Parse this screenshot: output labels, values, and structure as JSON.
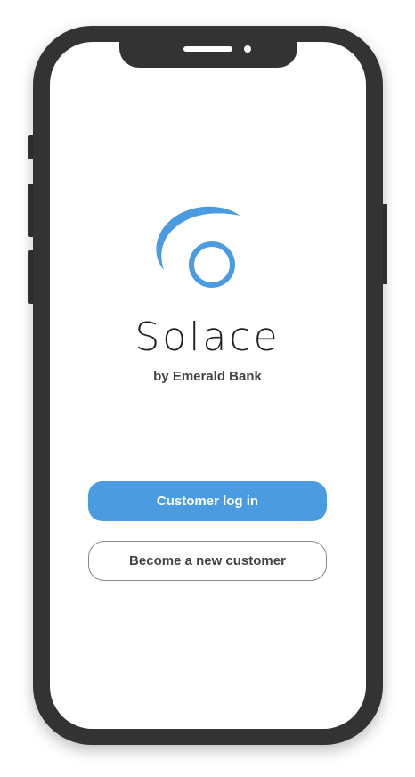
{
  "brand": {
    "name": "Solace",
    "subtitle": "by Emerald Bank",
    "logo_icon": "solace-swirl-logo",
    "accent_color": "#4a9be0"
  },
  "actions": {
    "login_label": "Customer log in",
    "signup_label": "Become a new customer"
  },
  "device": {
    "frame_color": "#333333"
  }
}
